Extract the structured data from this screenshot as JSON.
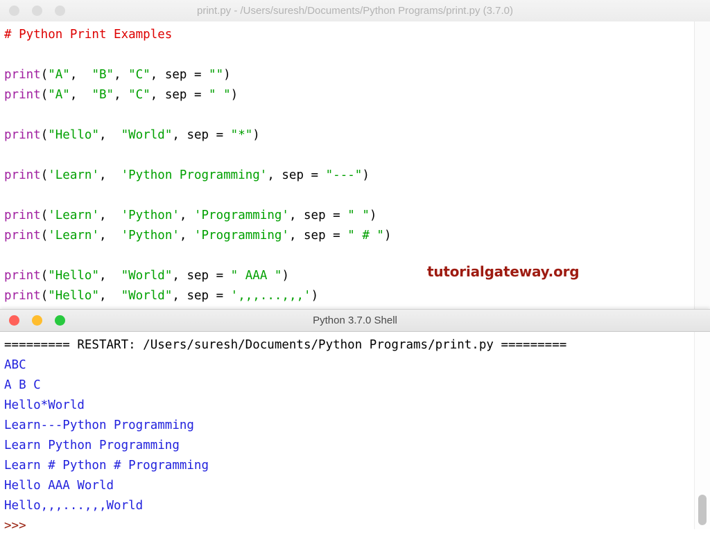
{
  "editor_window": {
    "title": "print.py - /Users/suresh/Documents/Python Programs/print.py (3.7.0)",
    "active": false,
    "traffic_lights": [
      "close-button",
      "minimize-button",
      "maximize-button"
    ],
    "code_lines": [
      {
        "type": "comment",
        "text": "# Python Print Examples"
      },
      {
        "type": "blank",
        "text": ""
      },
      {
        "type": "code",
        "segments": [
          {
            "cls": "kw",
            "text": "print"
          },
          {
            "cls": "plain",
            "text": "("
          },
          {
            "cls": "str",
            "text": "\"A\""
          },
          {
            "cls": "plain",
            "text": ",  "
          },
          {
            "cls": "str",
            "text": "\"B\""
          },
          {
            "cls": "plain",
            "text": ", "
          },
          {
            "cls": "str",
            "text": "\"C\""
          },
          {
            "cls": "plain",
            "text": ", sep = "
          },
          {
            "cls": "str",
            "text": "\"\""
          },
          {
            "cls": "plain",
            "text": ")"
          }
        ]
      },
      {
        "type": "code",
        "segments": [
          {
            "cls": "kw",
            "text": "print"
          },
          {
            "cls": "plain",
            "text": "("
          },
          {
            "cls": "str",
            "text": "\"A\""
          },
          {
            "cls": "plain",
            "text": ",  "
          },
          {
            "cls": "str",
            "text": "\"B\""
          },
          {
            "cls": "plain",
            "text": ", "
          },
          {
            "cls": "str",
            "text": "\"C\""
          },
          {
            "cls": "plain",
            "text": ", sep = "
          },
          {
            "cls": "str",
            "text": "\" \""
          },
          {
            "cls": "plain",
            "text": ")"
          }
        ]
      },
      {
        "type": "blank",
        "text": ""
      },
      {
        "type": "code",
        "segments": [
          {
            "cls": "kw",
            "text": "print"
          },
          {
            "cls": "plain",
            "text": "("
          },
          {
            "cls": "str",
            "text": "\"Hello\""
          },
          {
            "cls": "plain",
            "text": ",  "
          },
          {
            "cls": "str",
            "text": "\"World\""
          },
          {
            "cls": "plain",
            "text": ", sep = "
          },
          {
            "cls": "str",
            "text": "\"*\""
          },
          {
            "cls": "plain",
            "text": ")"
          }
        ]
      },
      {
        "type": "blank",
        "text": ""
      },
      {
        "type": "code",
        "segments": [
          {
            "cls": "kw",
            "text": "print"
          },
          {
            "cls": "plain",
            "text": "("
          },
          {
            "cls": "str",
            "text": "'Learn'"
          },
          {
            "cls": "plain",
            "text": ",  "
          },
          {
            "cls": "str",
            "text": "'Python Programming'"
          },
          {
            "cls": "plain",
            "text": ", sep = "
          },
          {
            "cls": "str",
            "text": "\"---\""
          },
          {
            "cls": "plain",
            "text": ")"
          }
        ]
      },
      {
        "type": "blank",
        "text": ""
      },
      {
        "type": "code",
        "segments": [
          {
            "cls": "kw",
            "text": "print"
          },
          {
            "cls": "plain",
            "text": "("
          },
          {
            "cls": "str",
            "text": "'Learn'"
          },
          {
            "cls": "plain",
            "text": ",  "
          },
          {
            "cls": "str",
            "text": "'Python'"
          },
          {
            "cls": "plain",
            "text": ", "
          },
          {
            "cls": "str",
            "text": "'Programming'"
          },
          {
            "cls": "plain",
            "text": ", sep = "
          },
          {
            "cls": "str",
            "text": "\" \""
          },
          {
            "cls": "plain",
            "text": ")"
          }
        ]
      },
      {
        "type": "code",
        "segments": [
          {
            "cls": "kw",
            "text": "print"
          },
          {
            "cls": "plain",
            "text": "("
          },
          {
            "cls": "str",
            "text": "'Learn'"
          },
          {
            "cls": "plain",
            "text": ",  "
          },
          {
            "cls": "str",
            "text": "'Python'"
          },
          {
            "cls": "plain",
            "text": ", "
          },
          {
            "cls": "str",
            "text": "'Programming'"
          },
          {
            "cls": "plain",
            "text": ", sep = "
          },
          {
            "cls": "str",
            "text": "\" # \""
          },
          {
            "cls": "plain",
            "text": ")"
          }
        ]
      },
      {
        "type": "blank",
        "text": ""
      },
      {
        "type": "code",
        "segments": [
          {
            "cls": "kw",
            "text": "print"
          },
          {
            "cls": "plain",
            "text": "("
          },
          {
            "cls": "str",
            "text": "\"Hello\""
          },
          {
            "cls": "plain",
            "text": ",  "
          },
          {
            "cls": "str",
            "text": "\"World\""
          },
          {
            "cls": "plain",
            "text": ", sep = "
          },
          {
            "cls": "str",
            "text": "\" AAA \""
          },
          {
            "cls": "plain",
            "text": ")"
          }
        ]
      },
      {
        "type": "code",
        "segments": [
          {
            "cls": "kw",
            "text": "print"
          },
          {
            "cls": "plain",
            "text": "("
          },
          {
            "cls": "str",
            "text": "\"Hello\""
          },
          {
            "cls": "plain",
            "text": ",  "
          },
          {
            "cls": "str",
            "text": "\"World\""
          },
          {
            "cls": "plain",
            "text": ", sep = "
          },
          {
            "cls": "str",
            "text": "',,,...,,,'"
          },
          {
            "cls": "plain",
            "text": ")"
          }
        ]
      }
    ]
  },
  "watermark": {
    "text": "tutorialgateway.org",
    "color": "#9e1b11"
  },
  "shell_window": {
    "title": "Python 3.7.0 Shell",
    "active": true,
    "traffic_lights": [
      "close-button",
      "minimize-button",
      "maximize-button"
    ],
    "lines": [
      {
        "cls": "restart",
        "text": "========= RESTART: /Users/suresh/Documents/Python Programs/print.py ========="
      },
      {
        "cls": "out",
        "text": "ABC"
      },
      {
        "cls": "out",
        "text": "A B C"
      },
      {
        "cls": "out",
        "text": "Hello*World"
      },
      {
        "cls": "out",
        "text": "Learn---Python Programming"
      },
      {
        "cls": "out",
        "text": "Learn Python Programming"
      },
      {
        "cls": "out",
        "text": "Learn # Python # Programming"
      },
      {
        "cls": "out",
        "text": "Hello AAA World"
      },
      {
        "cls": "out",
        "text": "Hello,,,...,,,World"
      },
      {
        "cls": "prompt",
        "text": ">>>"
      }
    ]
  },
  "colors": {
    "comment": "#dd0000",
    "keyword": "#a020a0",
    "string": "#00a000",
    "output": "#2222dd",
    "prompt": "#992211",
    "watermark": "#9e1b11"
  }
}
